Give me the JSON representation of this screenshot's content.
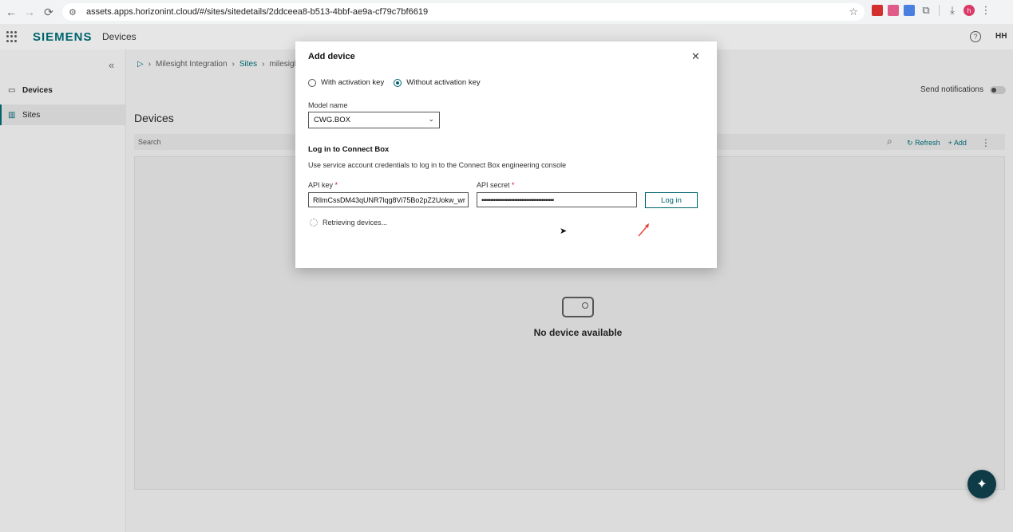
{
  "browser": {
    "url": "assets.apps.horizonint.cloud/#/sites/sitedetails/2ddceea8-b513-4bbf-ae9a-cf79c7bf6619",
    "profile_initial": "h"
  },
  "header": {
    "brand": "SIEMENS",
    "app_name": "Devices",
    "user_initials": "HH",
    "help": "?"
  },
  "sidebar": {
    "items": [
      {
        "label": "Devices",
        "icon": "device-icon"
      },
      {
        "label": "Sites",
        "icon": "building-icon"
      }
    ]
  },
  "breadcrumb": {
    "items": [
      "Milesight Integration",
      "Sites",
      "milesigh"
    ]
  },
  "main": {
    "send_notifications_label": "Send notifications",
    "title": "Devices",
    "search_placeholder": "Search",
    "refresh_label": "Refresh",
    "add_label": "Add",
    "empty_text": "No device available"
  },
  "modal": {
    "title": "Add device",
    "radio_with": "With activation key",
    "radio_without": "Without activation key",
    "model_label": "Model name",
    "model_value": "CWG.BOX",
    "section_title": "Log in to Connect Box",
    "section_desc": "Use service account credentials to log in to the Connect Box engineering console",
    "api_key_label": "API key",
    "api_key_value": "RIlmCssDM43qUNR7lqg8Vi75Bo2pZ2Uokw_wr",
    "api_secret_label": "API secret",
    "api_secret_value": "••••••••••••••••••••••••••••••••••••••••••",
    "login_label": "Log in",
    "loading_text": "Retrieving devices...",
    "required_mark": "*"
  },
  "colors": {
    "accent": "#00646e",
    "required": "#c8102e",
    "fab": "#0f3b46",
    "annotation_arrow": "#e8463c"
  }
}
